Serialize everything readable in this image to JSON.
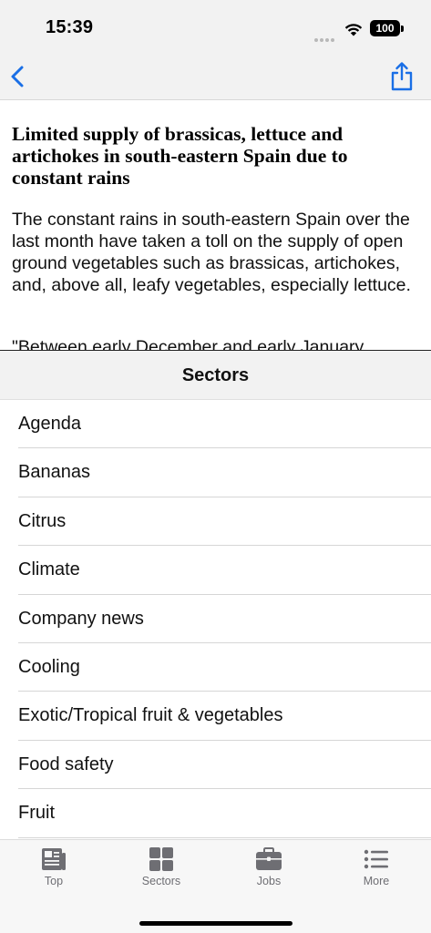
{
  "status_bar": {
    "time": "15:39",
    "battery": "100",
    "icons": [
      "cellular-dots-icon",
      "wifi-icon",
      "battery-icon"
    ]
  },
  "nav": {
    "back_icon": "chevron-left-icon",
    "share_icon": "share-icon",
    "accent_color": "#1a6fe6"
  },
  "article": {
    "title": "Limited supply of brassicas, lettuce and artichokes in south-eastern Spain due to constant rains",
    "body": "The constant rains in south-eastern Spain over the last month have taken a toll on the supply of open ground vegetables such as brassicas, artichokes, and, above all, leafy vegetables, especially lettuce.",
    "quote_start": "\"Between early December and early January"
  },
  "sectors": {
    "title": "Sectors",
    "items": [
      {
        "label": "Agenda"
      },
      {
        "label": "Bananas"
      },
      {
        "label": "Citrus"
      },
      {
        "label": "Climate"
      },
      {
        "label": "Company news"
      },
      {
        "label": "Cooling"
      },
      {
        "label": "Exotic/Tropical fruit & vegetables"
      },
      {
        "label": "Food safety"
      },
      {
        "label": "Fruit"
      }
    ]
  },
  "tab_bar": {
    "tabs": [
      {
        "label": "Top",
        "icon": "newspaper-icon"
      },
      {
        "label": "Sectors",
        "icon": "grid-icon"
      },
      {
        "label": "Jobs",
        "icon": "briefcase-icon"
      },
      {
        "label": "More",
        "icon": "list-icon"
      }
    ],
    "inactive_color": "#6e6e73"
  }
}
